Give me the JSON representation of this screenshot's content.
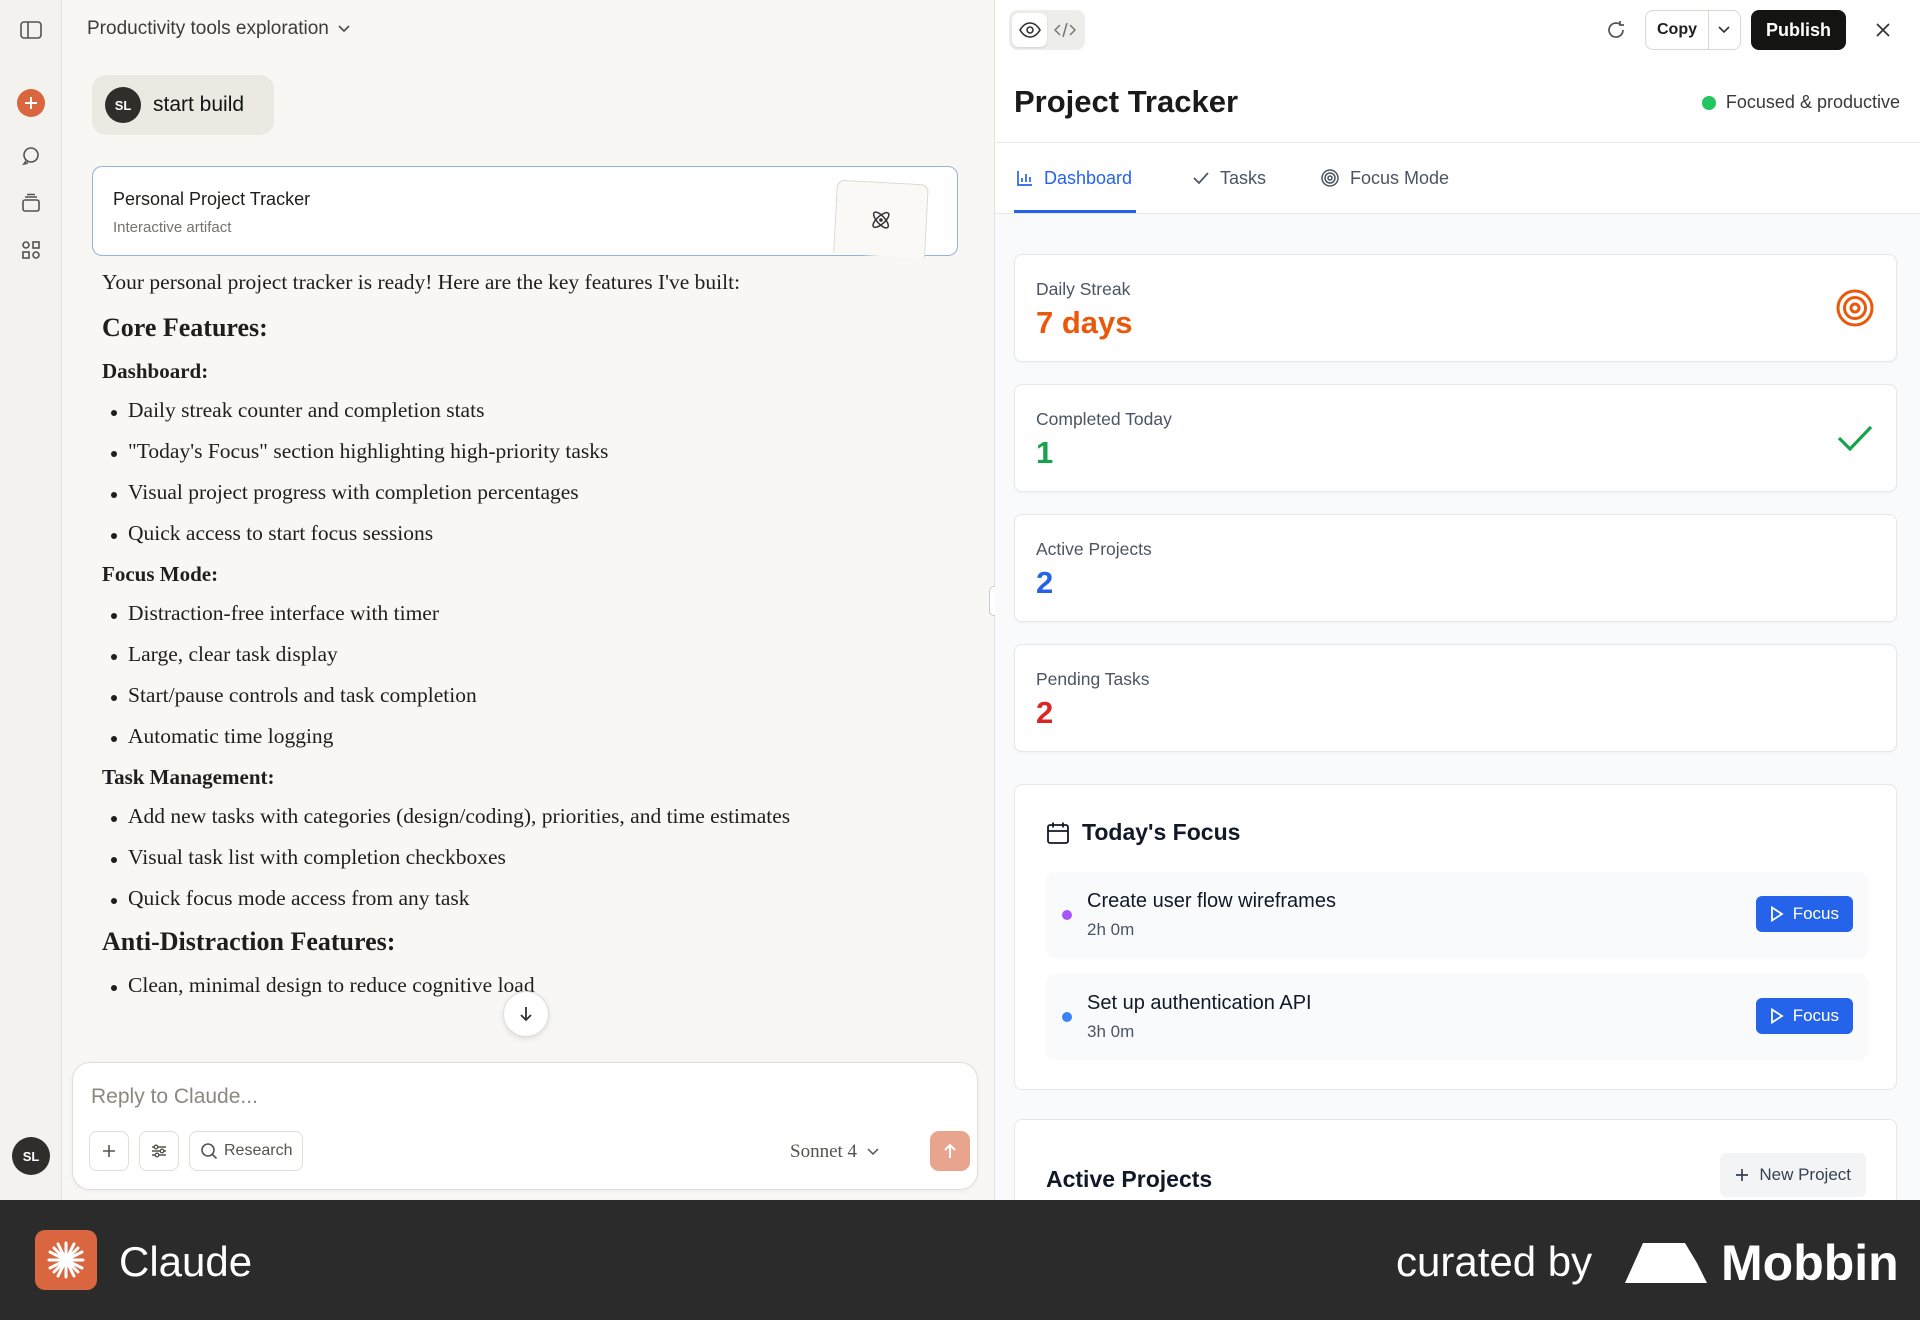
{
  "sidebar": {
    "avatar_initials": "SL",
    "icons": [
      "sidebar-toggle-icon",
      "new-chat-icon",
      "chats-icon",
      "projects-icon",
      "artifacts-icon"
    ]
  },
  "chat": {
    "title": "Productivity tools exploration",
    "user_message": "start build",
    "user_initials": "SL",
    "artifact": {
      "title": "Personal Project Tracker",
      "subtitle": "Interactive artifact"
    },
    "response": {
      "intro": "Your personal project tracker is ready! Here are the key features I've built:",
      "heading_core": "Core Features:",
      "sections": [
        {
          "title": "Dashboard:",
          "items": [
            "Daily streak counter and completion stats",
            "\"Today's Focus\" section highlighting high-priority tasks",
            "Visual project progress with completion percentages",
            "Quick access to start focus sessions"
          ]
        },
        {
          "title": "Focus Mode:",
          "items": [
            "Distraction-free interface with timer",
            "Large, clear task display",
            "Start/pause controls and task completion",
            "Automatic time logging"
          ]
        },
        {
          "title": "Task Management:",
          "items": [
            "Add new tasks with categories (design/coding), priorities, and time estimates",
            "Visual task list with completion checkboxes",
            "Quick focus mode access from any task"
          ]
        }
      ],
      "heading_anti": "Anti-Distraction Features:",
      "anti_items": [
        "Clean, minimal design to reduce cognitive load"
      ]
    },
    "composer": {
      "placeholder": "Reply to Claude...",
      "research_label": "Research",
      "model": "Sonnet 4"
    }
  },
  "panel": {
    "copy_label": "Copy",
    "publish_label": "Publish",
    "title": "Project Tracker",
    "status": "Focused & productive",
    "status_color": "#22c55e",
    "tabs": [
      {
        "label": "Dashboard",
        "active": true
      },
      {
        "label": "Tasks"
      },
      {
        "label": "Focus Mode"
      }
    ],
    "stats": [
      {
        "label": "Daily Streak",
        "value": "7 days",
        "color": "#ea580c",
        "icon": "target-icon"
      },
      {
        "label": "Completed Today",
        "value": "1",
        "color": "#16a34a",
        "icon": "check-icon"
      },
      {
        "label": "Active Projects",
        "value": "2",
        "color": "#2563eb"
      },
      {
        "label": "Pending Tasks",
        "value": "2",
        "color": "#dc2626"
      }
    ],
    "todays_focus": {
      "title": "Today's Focus",
      "tasks": [
        {
          "name": "Create user flow wireframes",
          "time": "2h 0m",
          "dot_color": "#a855f7",
          "button": "Focus"
        },
        {
          "name": "Set up authentication API",
          "time": "3h 0m",
          "dot_color": "#3b82f6",
          "button": "Focus"
        }
      ]
    },
    "active_projects": {
      "title": "Active Projects",
      "new_button": "New Project"
    }
  },
  "footer": {
    "brand": "Claude",
    "curated": "curated by",
    "mobbin": "Mobbin"
  }
}
